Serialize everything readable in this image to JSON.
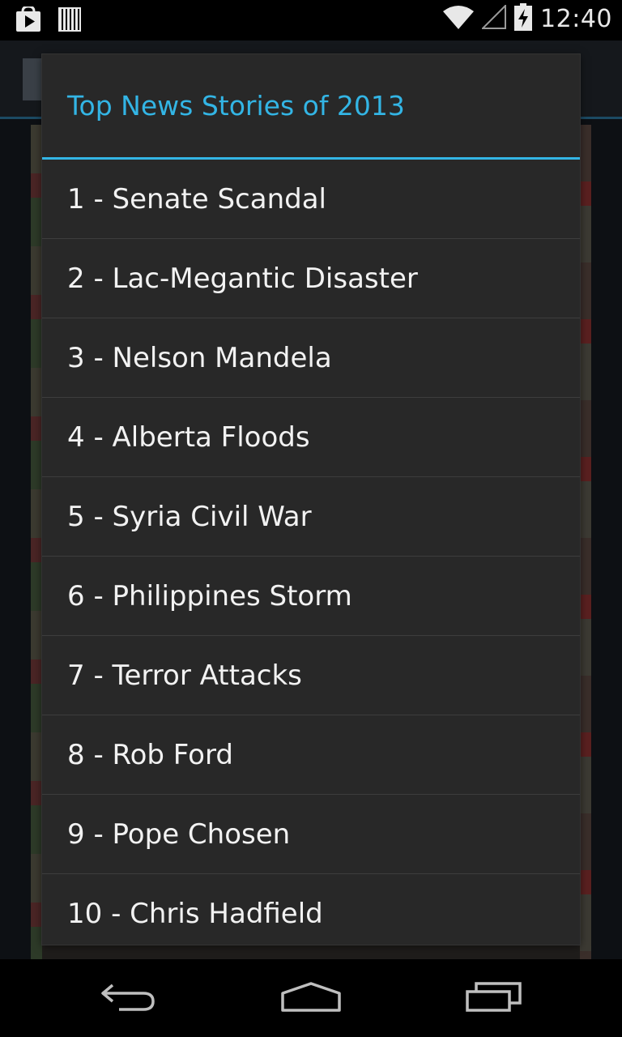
{
  "status_bar": {
    "time": "12:40",
    "left_icons": [
      "play-store-notification-icon",
      "barcode-notification-icon"
    ],
    "right_icons": [
      "wifi-icon",
      "cell-signal-icon",
      "battery-charging-icon"
    ]
  },
  "dialog": {
    "title": "Top News Stories of 2013",
    "accent_color": "#33b5e5",
    "items": [
      {
        "label": "1 - Senate Scandal"
      },
      {
        "label": "2 - Lac-Megantic Disaster"
      },
      {
        "label": "3 - Nelson Mandela"
      },
      {
        "label": "4 - Alberta Floods"
      },
      {
        "label": "5 - Syria Civil War"
      },
      {
        "label": "6 - Philippines Storm"
      },
      {
        "label": "7 - Terror Attacks"
      },
      {
        "label": "8 - Rob Ford"
      },
      {
        "label": "9 - Pope Chosen"
      },
      {
        "label": "10 - Chris Hadfield"
      }
    ]
  },
  "nav_bar": {
    "buttons": [
      "back-icon",
      "home-icon",
      "recent-apps-icon"
    ]
  }
}
